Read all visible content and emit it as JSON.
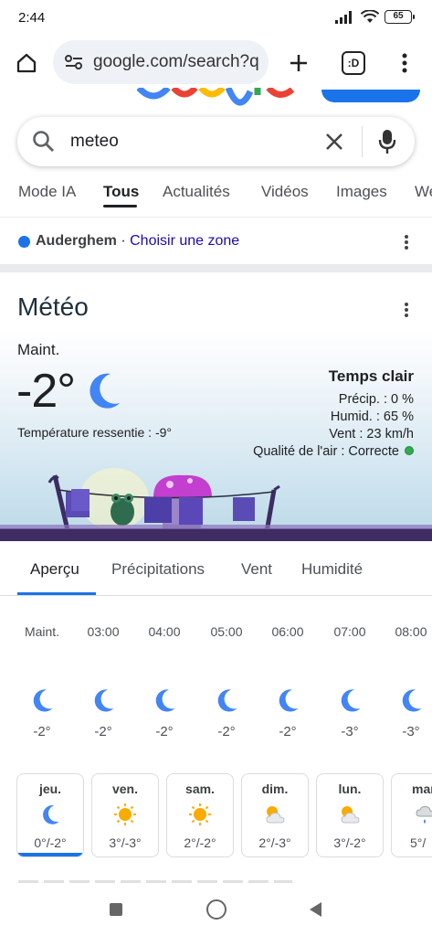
{
  "status": {
    "time": "2:44",
    "battery": "65"
  },
  "browser": {
    "url": "google.com/search?q",
    "tab_count": ":D"
  },
  "search": {
    "query": "meteo"
  },
  "tabs": [
    {
      "label": "Mode IA"
    },
    {
      "label": "Tous"
    },
    {
      "label": "Actualités"
    },
    {
      "label": "Vidéos"
    },
    {
      "label": "Images"
    },
    {
      "label": "We"
    }
  ],
  "location": {
    "name": "Auderghem",
    "separator": " · ",
    "link": "Choisir une zone"
  },
  "weather": {
    "title": "Météo",
    "now_label": "Maint.",
    "temperature": "-2°",
    "feels_like": "Température ressentie : -9°",
    "condition": "Temps clair",
    "precip": "Précip. : 0 %",
    "humidity": "Humid. : 65 %",
    "wind": "Vent : 23 km/h",
    "air_quality": "Qualité de l'air : Correcte",
    "air_quality_color": "#34a853"
  },
  "sub_tabs": [
    {
      "label": "Aperçu"
    },
    {
      "label": "Précipitations"
    },
    {
      "label": "Vent"
    },
    {
      "label": "Humidité"
    }
  ],
  "hourly": [
    {
      "time": "Maint.",
      "icon": "moon-icon",
      "temp": "-2°"
    },
    {
      "time": "03:00",
      "icon": "moon-icon",
      "temp": "-2°"
    },
    {
      "time": "04:00",
      "icon": "moon-icon",
      "temp": "-2°"
    },
    {
      "time": "05:00",
      "icon": "moon-icon",
      "temp": "-2°"
    },
    {
      "time": "06:00",
      "icon": "moon-icon",
      "temp": "-2°"
    },
    {
      "time": "07:00",
      "icon": "moon-icon",
      "temp": "-3°"
    },
    {
      "time": "08:00",
      "icon": "moon-icon",
      "temp": "-3°"
    }
  ],
  "daily": [
    {
      "day": "jeu.",
      "icon": "moon-icon",
      "range": "0°/-2°"
    },
    {
      "day": "ven.",
      "icon": "sun-icon",
      "range": "3°/-3°"
    },
    {
      "day": "sam.",
      "icon": "sun-icon",
      "range": "2°/-2°"
    },
    {
      "day": "dim.",
      "icon": "partly-cloudy-icon",
      "range": "2°/-3°"
    },
    {
      "day": "lun.",
      "icon": "partly-cloudy-icon",
      "range": "3°/-2°"
    },
    {
      "day": "mar",
      "icon": "rain-icon",
      "range": "5°/"
    }
  ],
  "colors": {
    "accent": "#1a73e8",
    "moon": "#4285f4",
    "sun": "#f9ab00"
  }
}
